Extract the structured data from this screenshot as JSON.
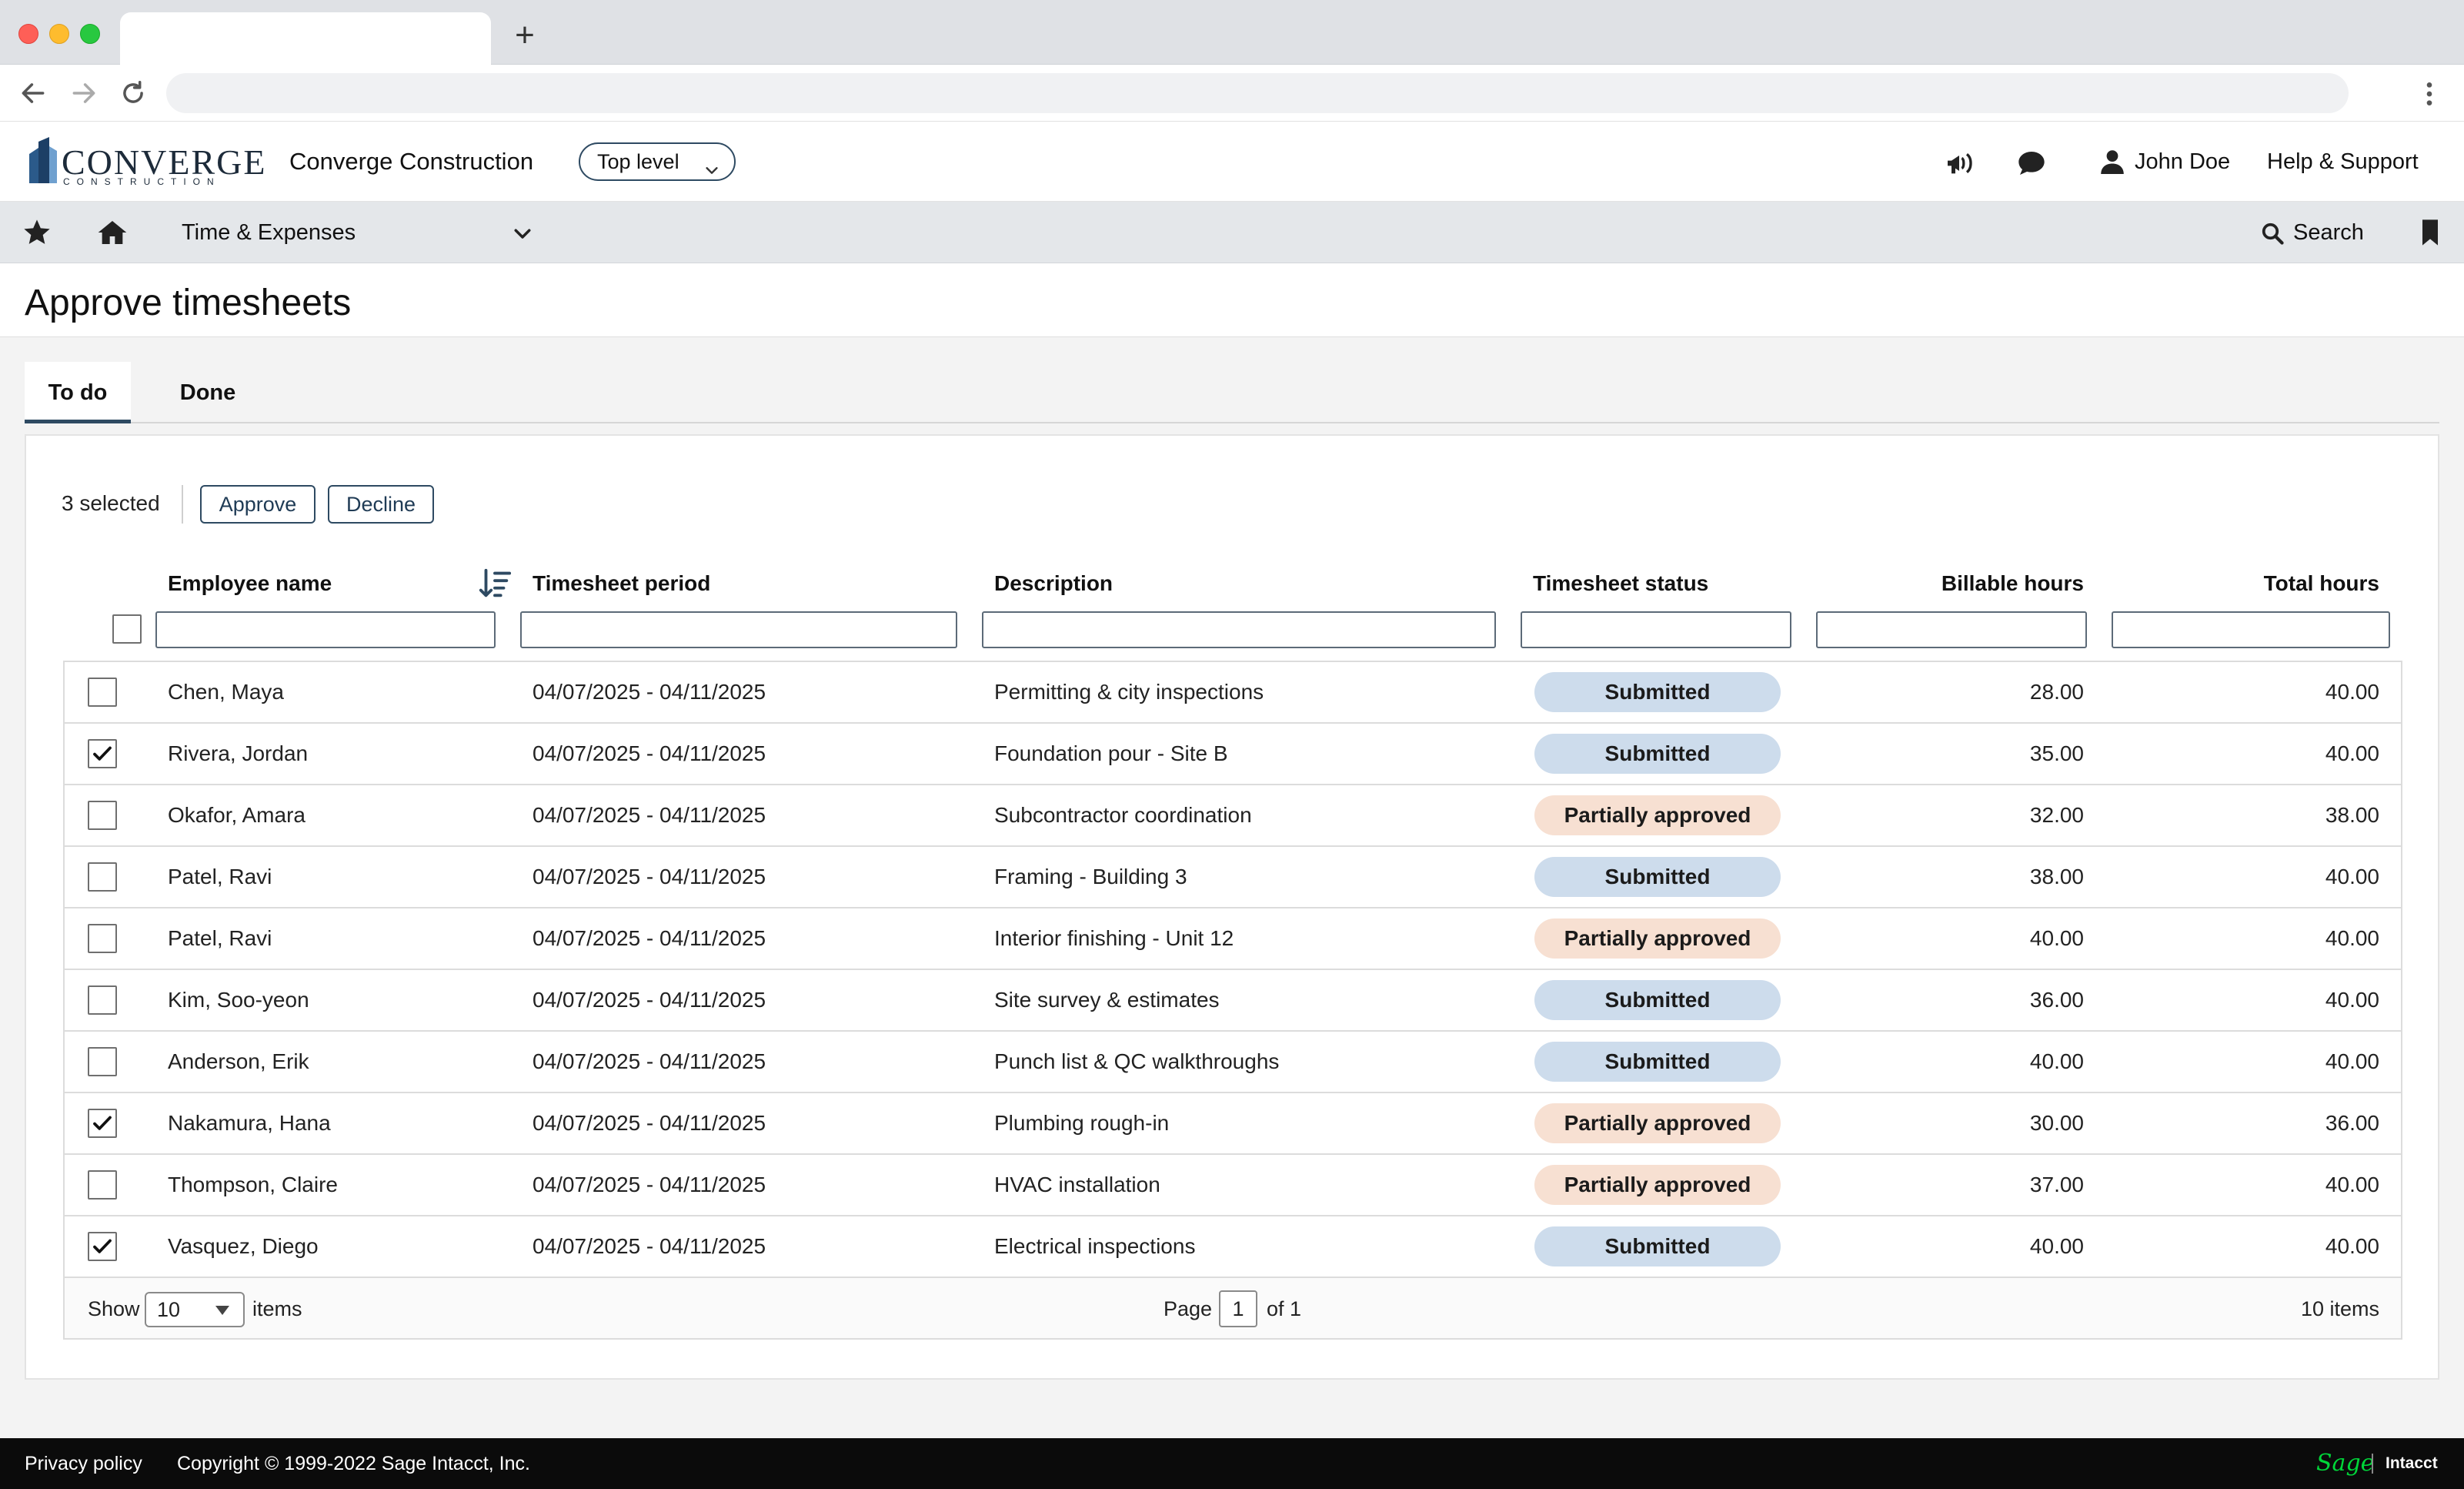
{
  "browser": {
    "new_tab_glyph": "+"
  },
  "header": {
    "logo_text": "CONVERGE",
    "logo_subtext": "CONSTRUCTION",
    "company_name": "Converge Construction",
    "level_select": "Top level",
    "user_name": "John Doe",
    "help_label": "Help & Support"
  },
  "nav": {
    "module": "Time & Expenses",
    "search_label": "Search"
  },
  "page": {
    "title": "Approve timesheets",
    "tabs": [
      {
        "label": "To do",
        "active": true
      },
      {
        "label": "Done",
        "active": false
      }
    ]
  },
  "bulk": {
    "selected_text": "3 selected",
    "approve_label": "Approve",
    "decline_label": "Decline"
  },
  "table": {
    "columns": [
      "Employee name",
      "Timesheet period",
      "Description",
      "Timesheet status",
      "Billable hours",
      "Total hours"
    ],
    "rows": [
      {
        "checked": false,
        "name": "Chen, Maya",
        "period": "04/07/2025 - 04/11/2025",
        "description": "Permitting & city inspections",
        "status": "Submitted",
        "billable": "28.00",
        "total": "40.00"
      },
      {
        "checked": true,
        "name": "Rivera, Jordan",
        "period": "04/07/2025 - 04/11/2025",
        "description": "Foundation pour - Site B",
        "status": "Submitted",
        "billable": "35.00",
        "total": "40.00"
      },
      {
        "checked": false,
        "name": "Okafor, Amara",
        "period": "04/07/2025 - 04/11/2025",
        "description": "Subcontractor coordination",
        "status": "Partially approved",
        "billable": "32.00",
        "total": "38.00"
      },
      {
        "checked": false,
        "name": "Patel, Ravi",
        "period": "04/07/2025 - 04/11/2025",
        "description": "Framing - Building 3",
        "status": "Submitted",
        "billable": "38.00",
        "total": "40.00"
      },
      {
        "checked": false,
        "name": "Patel, Ravi",
        "period": "04/07/2025 - 04/11/2025",
        "description": "Interior finishing - Unit 12",
        "status": "Partially approved",
        "billable": "40.00",
        "total": "40.00"
      },
      {
        "checked": false,
        "name": "Kim, Soo-yeon",
        "period": "04/07/2025 - 04/11/2025",
        "description": "Site survey & estimates",
        "status": "Submitted",
        "billable": "36.00",
        "total": "40.00"
      },
      {
        "checked": false,
        "name": "Anderson, Erik",
        "period": "04/07/2025 - 04/11/2025",
        "description": "Punch list & QC walkthroughs",
        "status": "Submitted",
        "billable": "40.00",
        "total": "40.00"
      },
      {
        "checked": true,
        "name": "Nakamura, Hana",
        "period": "04/07/2025 - 04/11/2025",
        "description": "Plumbing rough-in",
        "status": "Partially approved",
        "billable": "30.00",
        "total": "36.00"
      },
      {
        "checked": false,
        "name": "Thompson, Claire",
        "period": "04/07/2025 - 04/11/2025",
        "description": "HVAC installation",
        "status": "Partially approved",
        "billable": "37.00",
        "total": "40.00"
      },
      {
        "checked": true,
        "name": "Vasquez, Diego",
        "period": "04/07/2025 - 04/11/2025",
        "description": "Electrical inspections",
        "status": "Submitted",
        "billable": "40.00",
        "total": "40.00"
      }
    ],
    "status_colors": {
      "Submitted": "#cddcec",
      "Partially approved": "#f7e0d2"
    }
  },
  "pager": {
    "show_label": "Show",
    "page_size": "10",
    "items_label": "items",
    "page_label": "Page",
    "page_number": "1",
    "of_label": "of 1",
    "total_items": "10 items"
  },
  "footer": {
    "privacy": "Privacy policy",
    "copyright": "Copyright © 1999-2022 Sage Intacct, Inc.",
    "brand_sage": "Sage",
    "brand_intacct": "Intacct"
  },
  "icons": [
    "back-icon",
    "forward-icon",
    "reload-icon",
    "more-vert-icon",
    "megaphone-icon",
    "chat-icon",
    "user-icon",
    "star-icon",
    "home-icon",
    "chevron-down-icon",
    "search-icon",
    "bookmark-icon",
    "sort-desc-icon",
    "checkmark-icon"
  ],
  "colors": {
    "accent": "#2e4a62",
    "nav_bg": "#e4e7ea",
    "footer_bg": "#0b0b0b",
    "sage_green": "#00d639"
  }
}
